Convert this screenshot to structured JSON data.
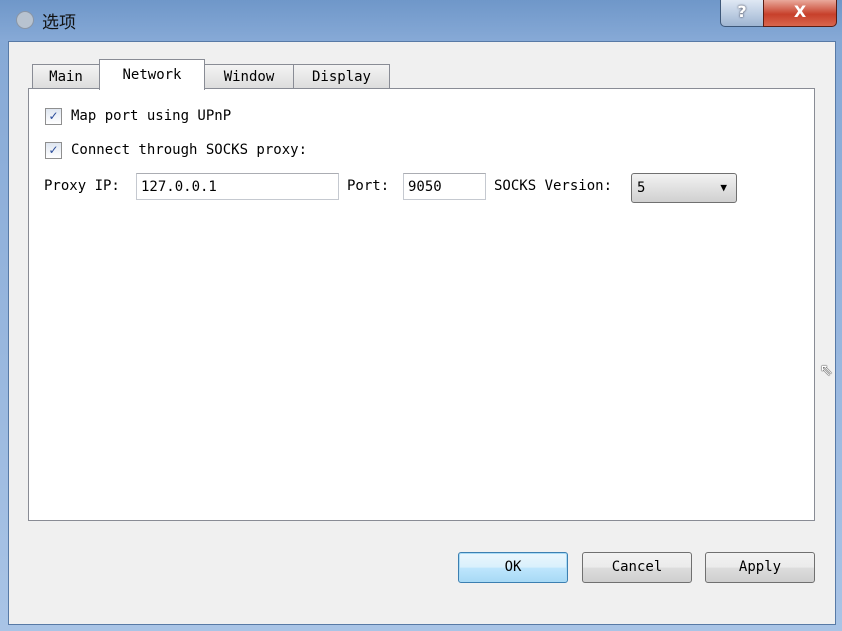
{
  "window": {
    "title": "选项",
    "help_label": "?",
    "close_label": "X"
  },
  "tabs": [
    {
      "label": "Main"
    },
    {
      "label": "Network",
      "active": true
    },
    {
      "label": "Window"
    },
    {
      "label": "Display"
    }
  ],
  "network": {
    "upnp": {
      "label": "Map port using UPnP",
      "checked": true
    },
    "socks": {
      "label": "Connect through SOCKS proxy:",
      "checked": true
    },
    "proxy_ip_label": "Proxy IP:",
    "proxy_ip_value": "127.0.0.1",
    "port_label": "Port:",
    "port_value": "9050",
    "socks_version_label": "SOCKS Version:",
    "socks_version_value": "5"
  },
  "buttons": {
    "ok": "OK",
    "cancel": "Cancel",
    "apply": "Apply"
  }
}
